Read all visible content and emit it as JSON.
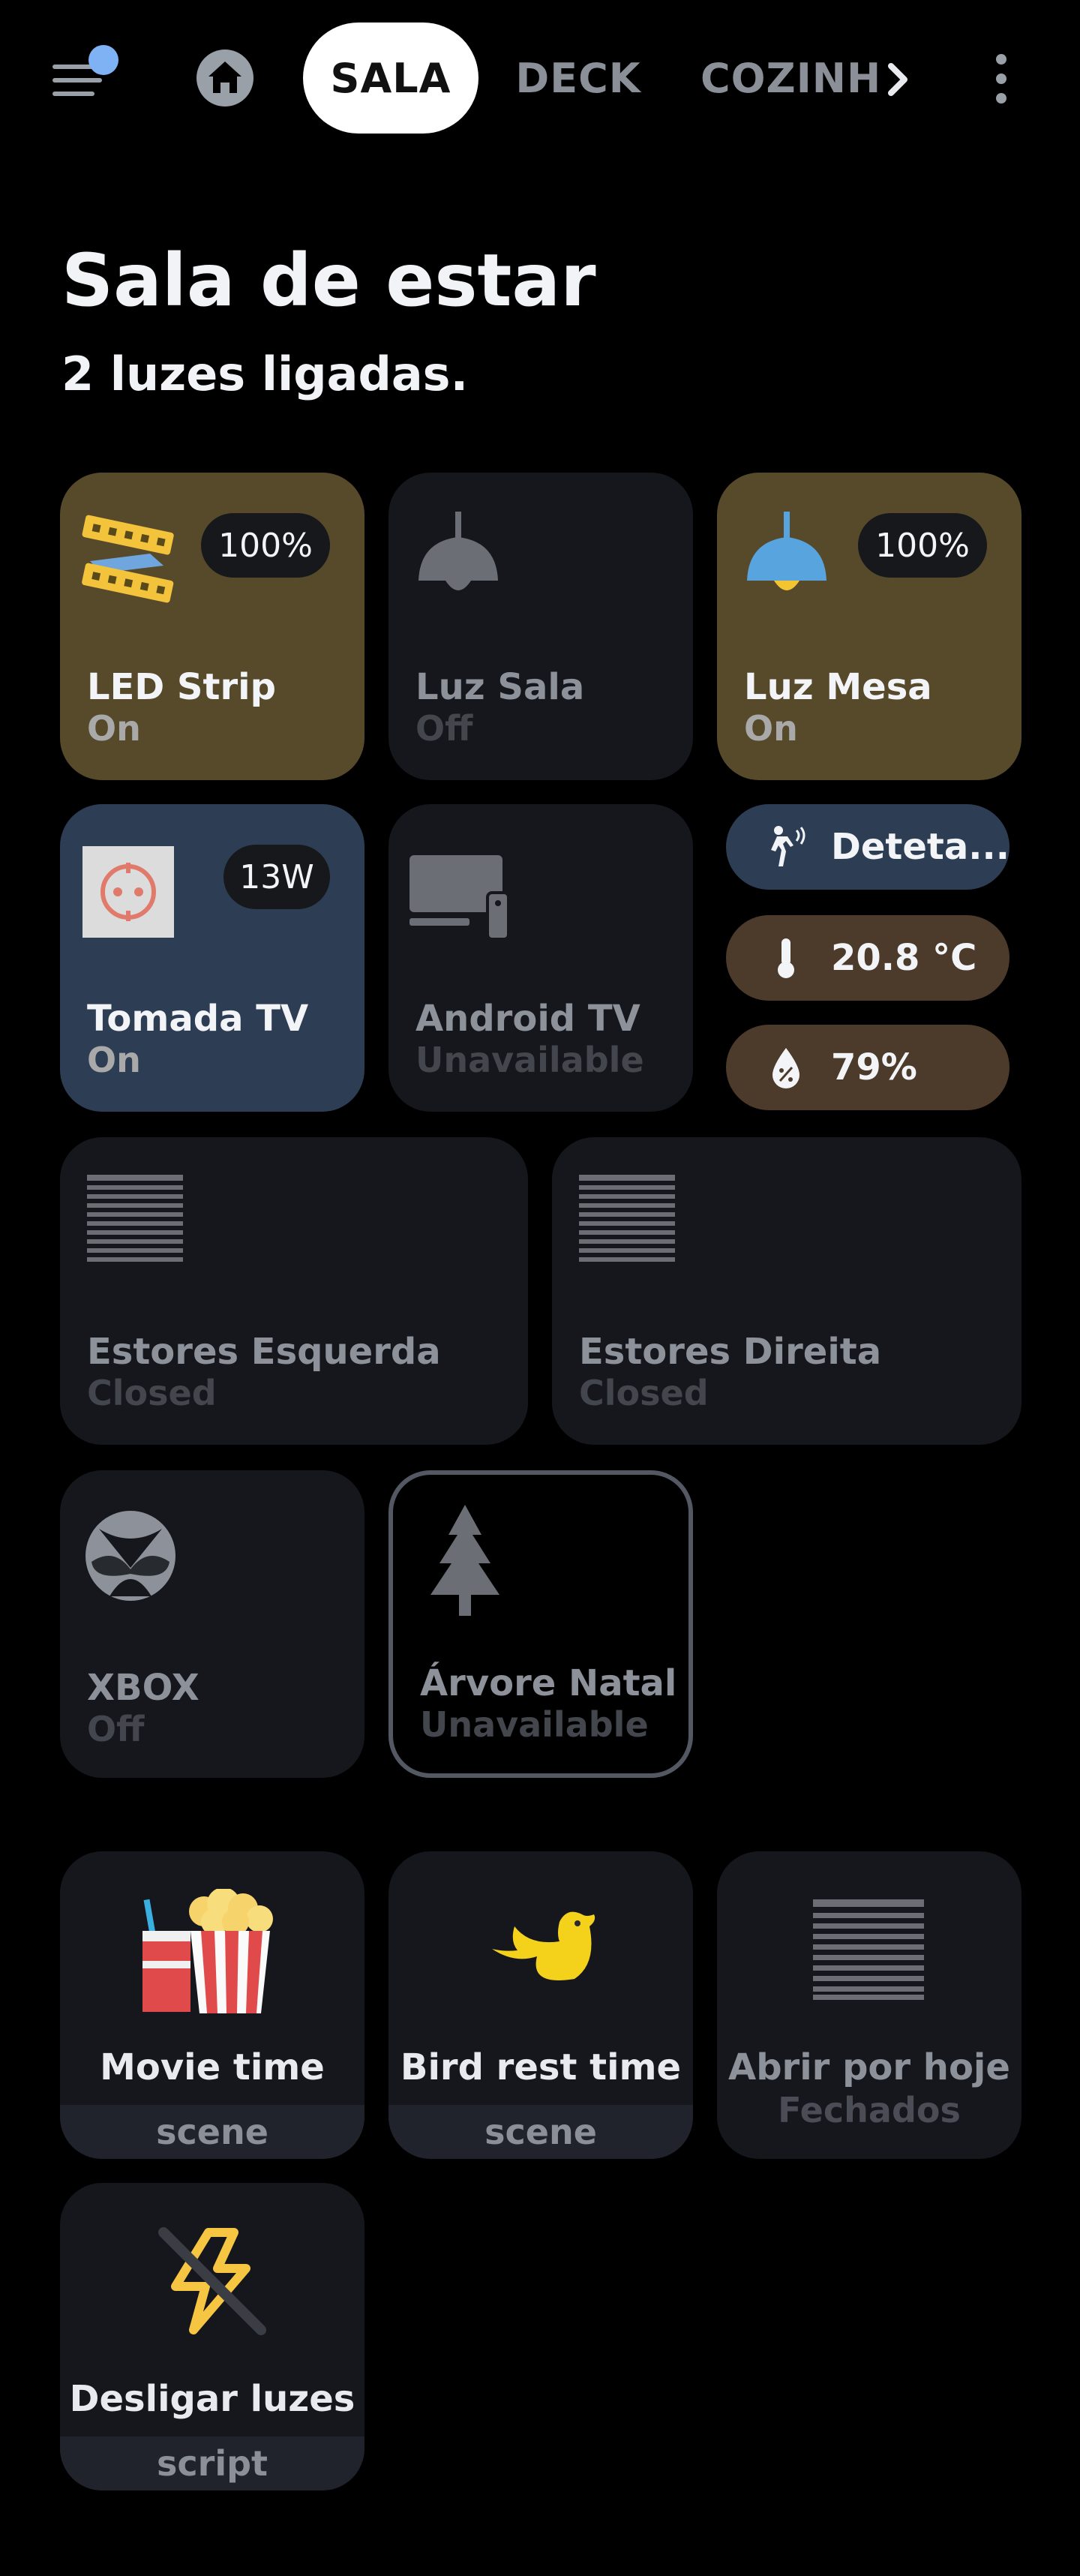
{
  "topbar": {
    "tabs": [
      "SALA",
      "DECK",
      "COZINH"
    ],
    "active_tab": "SALA"
  },
  "header": {
    "title": "Sala de estar",
    "subtitle": "2 luzes ligadas."
  },
  "tiles": [
    {
      "name": "LED Strip",
      "state": "On",
      "badge": "100%",
      "icon": "led-strip-icon"
    },
    {
      "name": "Luz Sala",
      "state": "Off",
      "icon": "ceiling-lamp-icon"
    },
    {
      "name": "Luz Mesa",
      "state": "On",
      "badge": "100%",
      "icon": "ceiling-lamp-icon"
    },
    {
      "name": "Tomada TV",
      "state": "On",
      "badge": "13W",
      "icon": "power-socket-icon"
    },
    {
      "name": "Android TV",
      "state": "Unavailable",
      "icon": "tv-box-icon"
    },
    {
      "name": "Estores Esquerda",
      "state": "Closed",
      "icon": "blinds-icon"
    },
    {
      "name": "Estores Direita",
      "state": "Closed",
      "icon": "blinds-icon"
    },
    {
      "name": "XBOX",
      "state": "Off",
      "icon": "xbox-icon"
    },
    {
      "name": "Árvore Natal",
      "state": "Unavailable",
      "icon": "pine-tree-icon"
    }
  ],
  "chips": [
    {
      "label": "Deteta...",
      "icon": "motion-sensor-icon"
    },
    {
      "label": "20.8 °C",
      "icon": "thermometer-icon"
    },
    {
      "label": "79%",
      "icon": "humidity-icon"
    }
  ],
  "scenes": [
    {
      "name": "Movie time",
      "type": "scene",
      "icon": "popcorn-icon"
    },
    {
      "name": "Bird rest time",
      "type": "scene",
      "icon": "bird-icon"
    },
    {
      "name": "Abrir por hoje",
      "state": "Fechados",
      "icon": "blinds-icon"
    },
    {
      "name": "Desligar luzes",
      "type": "script",
      "icon": "flash-off-icon"
    }
  ],
  "colors": {
    "background": "#000000",
    "tile_default": "#15171c",
    "tile_on_light": "#574a2b",
    "tile_on_socket": "#2d3d54",
    "accent_blue": "#7fb2f4"
  }
}
